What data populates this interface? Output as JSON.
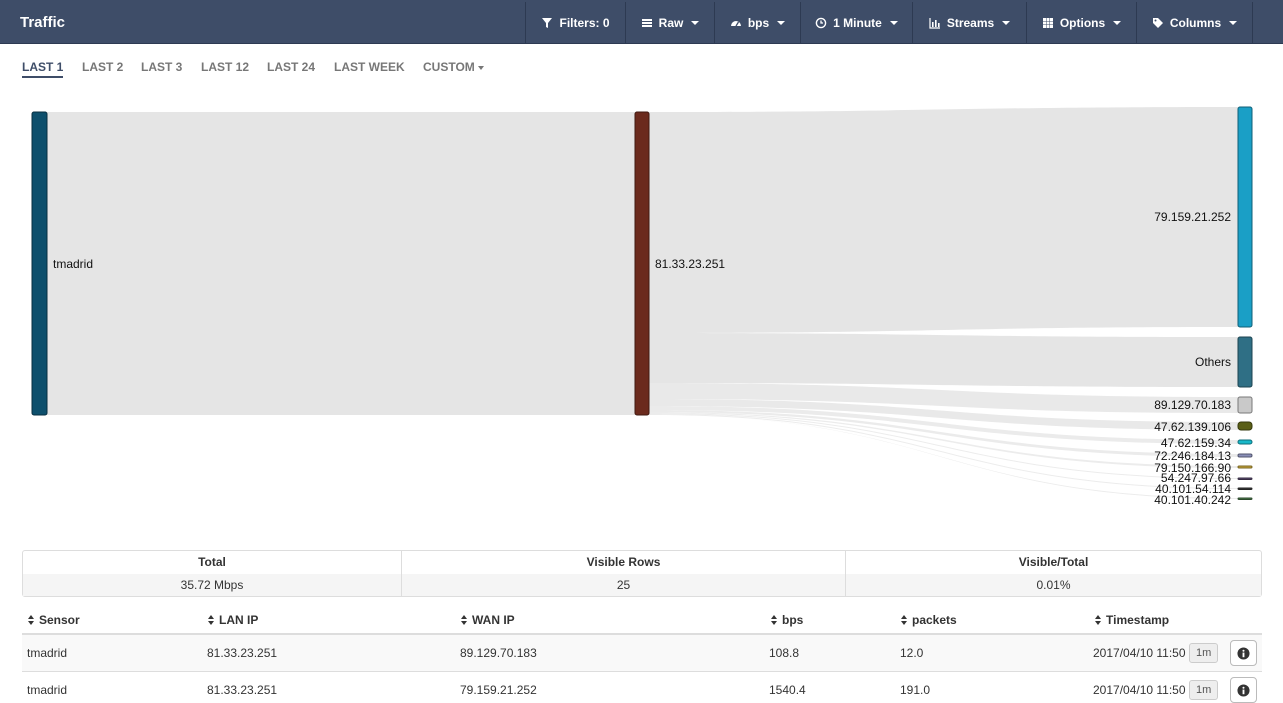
{
  "app": {
    "title": "Traffic"
  },
  "toolbar": {
    "filters": "Filters: 0",
    "raw": "Raw",
    "bps": "bps",
    "interval": "1 Minute",
    "streams": "Streams",
    "options": "Options",
    "columns": "Columns"
  },
  "tabs": [
    {
      "label": "LAST 1",
      "active": true
    },
    {
      "label": "LAST 2"
    },
    {
      "label": "LAST 3"
    },
    {
      "label": "LAST 12"
    },
    {
      "label": "LAST 24"
    },
    {
      "label": "LAST WEEK"
    },
    {
      "label": "CUSTOM"
    }
  ],
  "sankey": {
    "source": {
      "label": "tmadrid",
      "color": "#0d4f6c"
    },
    "middle": {
      "label": "81.33.23.251",
      "color": "#6b2a1d"
    },
    "targets": [
      {
        "label": "79.159.21.252",
        "color": "#1a9fc6"
      },
      {
        "label": "Others",
        "color": "#2f6f85"
      },
      {
        "label": "89.129.70.183",
        "color": "#c9c9c9"
      },
      {
        "label": "47.62.139.106",
        "color": "#5a5f16"
      },
      {
        "label": "47.62.159.34",
        "color": "#19b8c9"
      },
      {
        "label": "72.246.184.13",
        "color": "#8a8fb8"
      },
      {
        "label": "79.150.166.90",
        "color": "#c8a83a"
      },
      {
        "label": "54.247.97.66",
        "color": "#5a4a6f"
      },
      {
        "label": "40.101.54.114",
        "color": "#3a3a3a"
      },
      {
        "label": "40.101.40.242",
        "color": "#4a7a4a"
      }
    ]
  },
  "summary": {
    "total_label": "Total",
    "total_value": "35.72 Mbps",
    "visible_label": "Visible Rows",
    "visible_value": "25",
    "ratio_label": "Visible/Total",
    "ratio_value": "0.01%"
  },
  "table": {
    "headers": [
      "Sensor",
      "LAN IP",
      "WAN IP",
      "bps",
      "packets",
      "Timestamp"
    ],
    "rows": [
      {
        "sensor": "tmadrid",
        "lan_ip": "81.33.23.251",
        "wan_ip": "89.129.70.183",
        "bps": "108.8",
        "packets": "12.0",
        "timestamp": "2017/04/10 11:50",
        "badge": "1m"
      },
      {
        "sensor": "tmadrid",
        "lan_ip": "81.33.23.251",
        "wan_ip": "79.159.21.252",
        "bps": "1540.4",
        "packets": "191.0",
        "timestamp": "2017/04/10 11:50",
        "badge": "1m"
      }
    ]
  }
}
